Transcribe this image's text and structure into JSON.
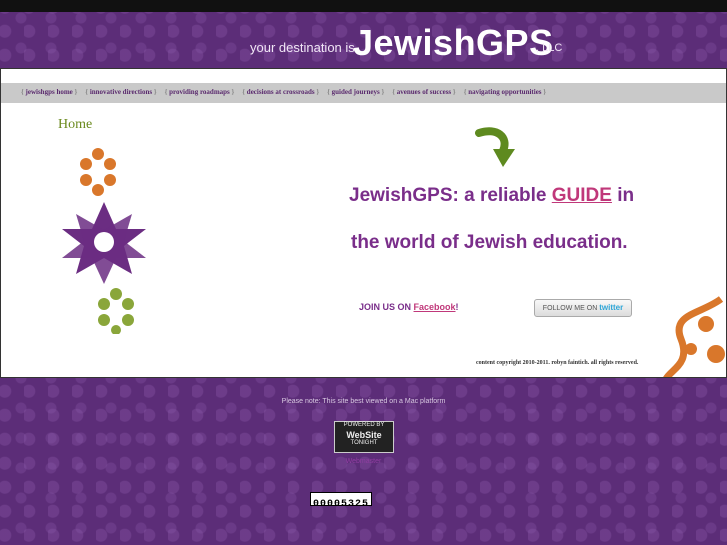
{
  "header": {
    "tagline_pre": "your destination is",
    "brand": "JewishGPS",
    "suffix": ", LLC"
  },
  "nav": {
    "items": [
      "jewishgps home",
      "innovative directions",
      "providing roadmaps",
      "decisions at crossroads",
      "guided journeys",
      "avenues of success",
      "navigating opportunities"
    ]
  },
  "main": {
    "home_label": "Home",
    "headline_part1": "JewishGPS: a reliable ",
    "headline_guide": "GUIDE",
    "headline_part1_end": " in",
    "headline_line2": "the world of Jewish education.",
    "join_text": "JOIN US ON ",
    "join_link": "Facebook",
    "join_end": "!",
    "twitter_button_pre": "FOLLOW ME ON ",
    "twitter_button_brand": "twitter",
    "copyright": "content copyright 2010-2011. robyn faintich. all rights reserved."
  },
  "footer": {
    "note": "Please note: This site best viewed on a Mac platform",
    "badge_top": "POWERED BY",
    "badge_main": "WebSite",
    "badge_sub": "TONIGHT",
    "badge_link": "Webmaster",
    "counter": "00005325"
  },
  "colors": {
    "background": "#5c2d78",
    "accent_purple": "#7a2e8a",
    "link_pink": "#c0387a",
    "home_green": "#6b8a1e"
  }
}
